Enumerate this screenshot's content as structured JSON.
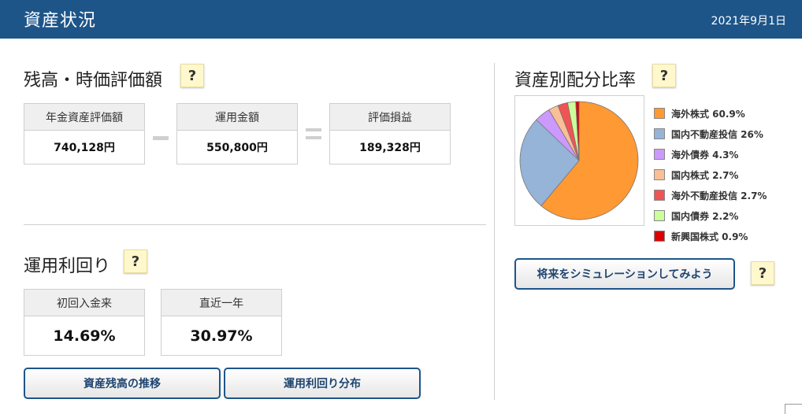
{
  "header": {
    "title": "資産状況",
    "date": "2021年9月1日"
  },
  "help_label": "?",
  "balance": {
    "title": "残高・時価評価額",
    "items": [
      {
        "label": "年金資産評価額",
        "value": "740,128円"
      },
      {
        "label": "運用金額",
        "value": "550,800円"
      },
      {
        "label": "評価損益",
        "value": "189,328円"
      }
    ]
  },
  "yield": {
    "title": "運用利回り",
    "items": [
      {
        "label": "初回入金来",
        "value": "14.69%"
      },
      {
        "label": "直近一年",
        "value": "30.97%"
      }
    ]
  },
  "buttons": {
    "balance_trend": "資産残高の推移",
    "yield_distribution": "運用利回り分布",
    "simulate": "将来をシミュレーションしてみよう"
  },
  "allocation": {
    "title": "資産別配分比率",
    "legend": [
      {
        "label": "海外株式 60.9%",
        "color": "#ff9933"
      },
      {
        "label": "国内不動産投信 26%",
        "color": "#96b3d8"
      },
      {
        "label": "海外債券 4.3%",
        "color": "#cc99ff"
      },
      {
        "label": "国内株式 2.7%",
        "color": "#f9bf96"
      },
      {
        "label": "海外不動産投信 2.7%",
        "color": "#f05454"
      },
      {
        "label": "国内債券 2.2%",
        "color": "#ccff99"
      },
      {
        "label": "新興国株式 0.9%",
        "color": "#dd0000"
      }
    ]
  },
  "chart_data": {
    "type": "pie",
    "categories": [
      "海外株式",
      "国内不動産投信",
      "海外債券",
      "国内株式",
      "海外不動産投信",
      "国内債券",
      "新興国株式"
    ],
    "values": [
      60.9,
      26,
      4.3,
      2.7,
      2.7,
      2.2,
      0.9
    ],
    "colors": [
      "#ff9933",
      "#96b3d8",
      "#cc99ff",
      "#f9bf96",
      "#f05454",
      "#ccff99",
      "#dd0000"
    ]
  }
}
